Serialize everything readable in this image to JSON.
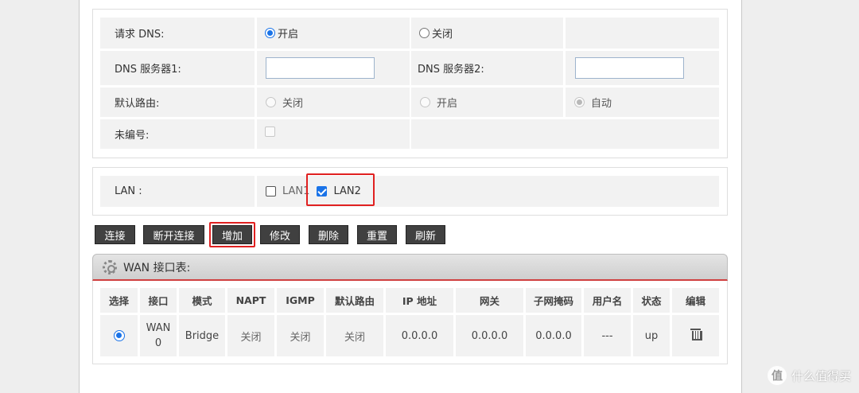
{
  "dns": {
    "request_label": "请求 DNS:",
    "request_on": "开启",
    "request_off": "关闭",
    "server1_label": "DNS 服务器1:",
    "server1_value": "",
    "server2_label": "DNS 服务器2:",
    "server2_value": "",
    "default_route_label": "默认路由:",
    "route_off": "关闭",
    "route_on": "开启",
    "route_auto": "自动",
    "unnumbered_label": "未编号:"
  },
  "lan": {
    "label": "LAN :",
    "lan1": "LAN1",
    "lan2": "LAN2"
  },
  "buttons": {
    "connect": "连接",
    "disconnect": "断开连接",
    "add": "增加",
    "modify": "修改",
    "delete": "删除",
    "reset": "重置",
    "refresh": "刷新"
  },
  "wan_table": {
    "title": "WAN 接口表:",
    "headers": [
      "选择",
      "接口",
      "模式",
      "NAPT",
      "IGMP",
      "默认路由",
      "IP 地址",
      "网关",
      "子网掩码",
      "用户名",
      "状态",
      "编辑"
    ],
    "rows": [
      {
        "interface_l1": "WAN",
        "interface_l2": "0",
        "mode": "Bridge",
        "napt": "关闭",
        "igmp": "关闭",
        "default_route": "关闭",
        "ip": "0.0.0.0",
        "gateway": "0.0.0.0",
        "mask": "0.0.0.0",
        "username": "---",
        "status": "up"
      }
    ]
  },
  "watermark": {
    "logo": "值",
    "text": "什么值得买"
  },
  "colors": {
    "accent": "#1a73e8",
    "button_bg": "#404040",
    "highlight": "#e02020"
  }
}
